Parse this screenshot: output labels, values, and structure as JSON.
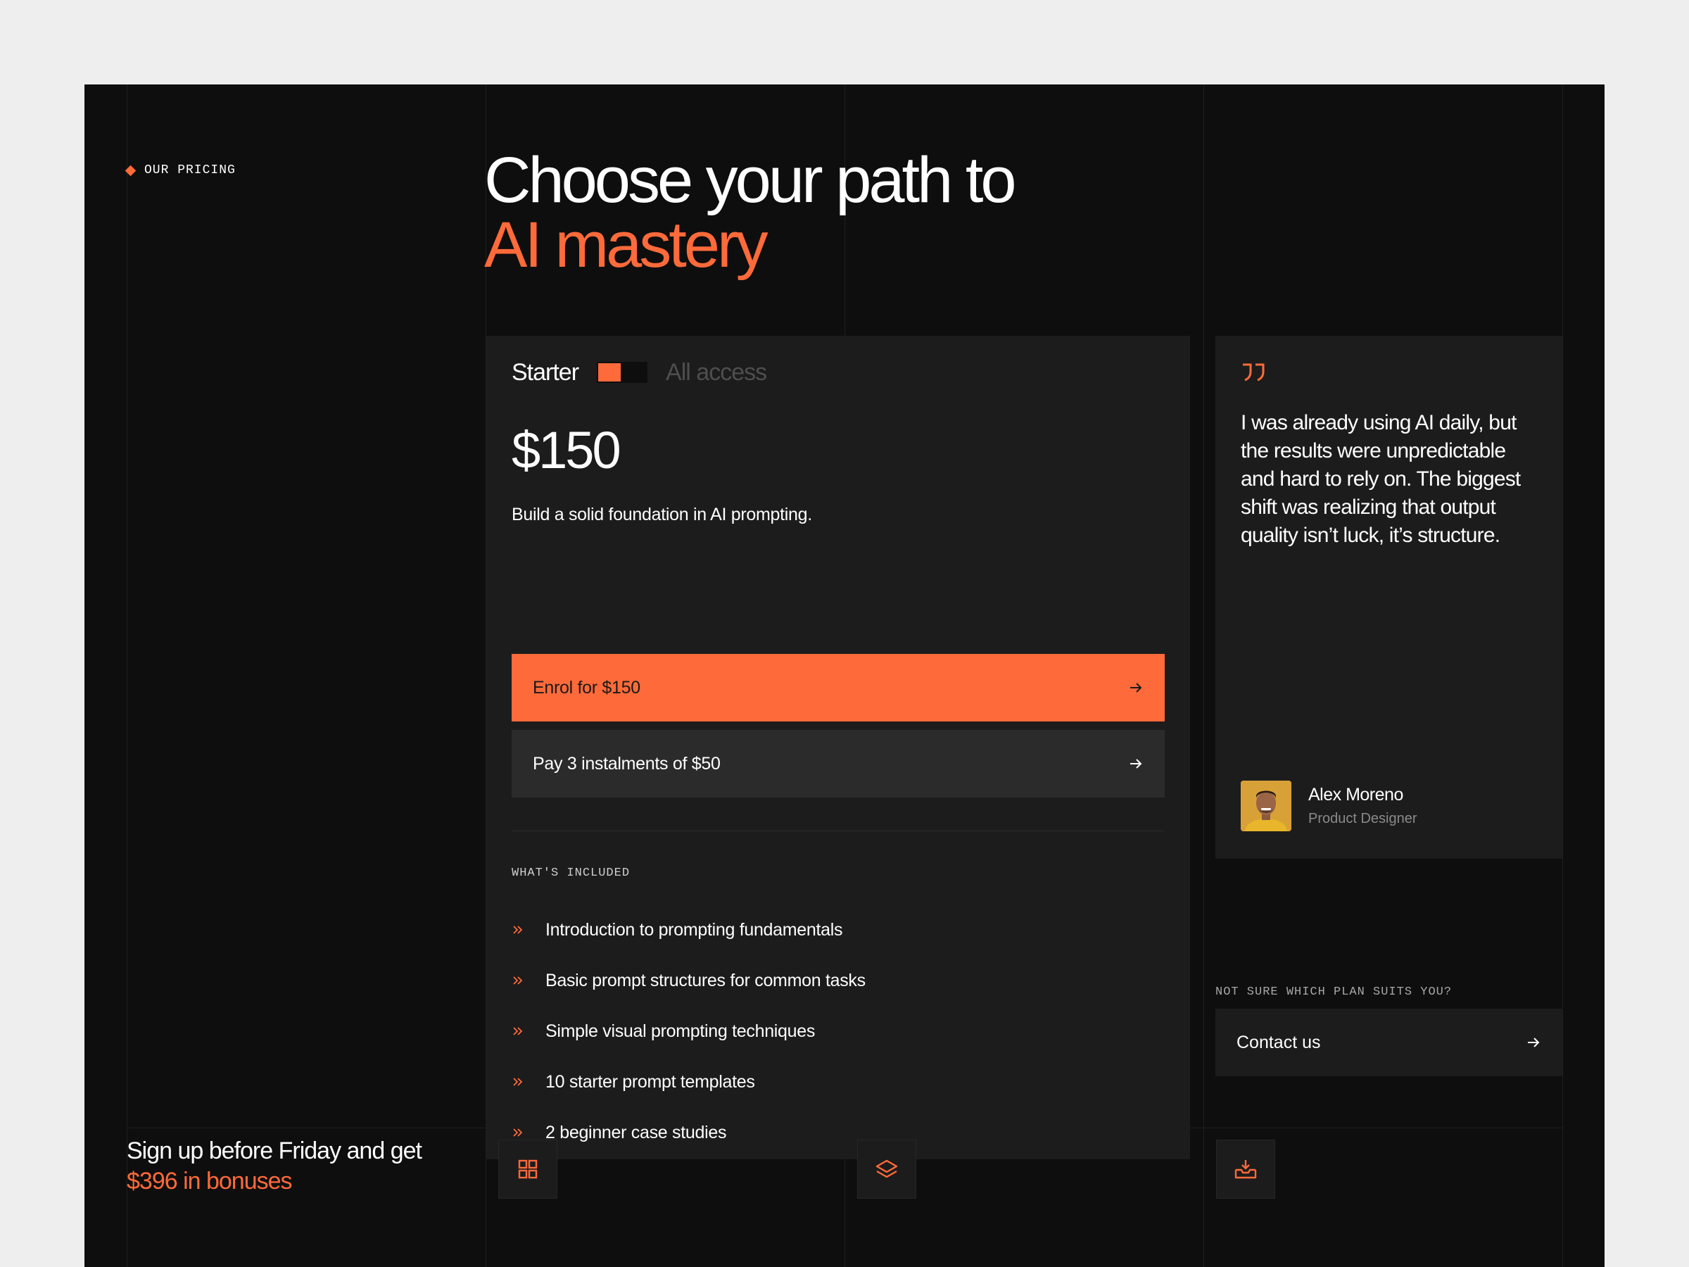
{
  "section": {
    "eyebrow": "OUR PRICING",
    "headline_line1": "Choose your path to",
    "headline_line2": "AI mastery"
  },
  "pricing": {
    "toggle": {
      "left_label": "Starter",
      "right_label": "All access",
      "selected": "Starter"
    },
    "price": "$150",
    "description": "Build a solid foundation in AI prompting.",
    "primary_button": "Enrol for $150",
    "secondary_button": "Pay 3 instalments of $50",
    "included_label": "WHAT'S INCLUDED",
    "features": [
      "Introduction to prompting fundamentals",
      "Basic prompt structures for common tasks",
      "Simple visual prompting techniques",
      "10 starter prompt templates",
      "2 beginner case studies"
    ]
  },
  "testimonial": {
    "quote": "I was already using AI daily, but the results were unpredictable and hard to rely on. The biggest shift was realizing that output quality isn’t luck, it’s structure.",
    "author_name": "Alex Moreno",
    "author_role": "Product Designer"
  },
  "contact": {
    "label": "NOT SURE WHICH PLAN SUITS YOU?",
    "button": "Contact us"
  },
  "bonus": {
    "line1": "Sign up before Friday and get",
    "line2": "$396 in bonuses"
  },
  "bonus_icons": [
    "grid-icon",
    "layers-icon",
    "inbox-download-icon"
  ],
  "colors": {
    "accent": "#ff6a3a",
    "page_background": "#0e0e0e",
    "card_background": "#1c1c1c",
    "secondary_button": "#2b2b2b",
    "outer_background": "#eeeeee"
  }
}
